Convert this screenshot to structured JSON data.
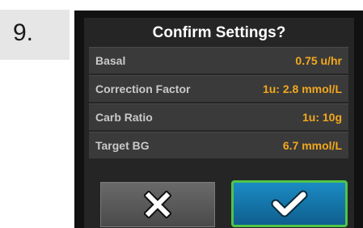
{
  "step": {
    "label": "9."
  },
  "dialog": {
    "title": "Confirm Settings?",
    "rows": [
      {
        "label": "Basal",
        "value": "0.75 u/hr"
      },
      {
        "label": "Correction Factor",
        "value": "1u: 2.8 mmol/L"
      },
      {
        "label": "Carb Ratio",
        "value": "1u: 10g"
      },
      {
        "label": "Target BG",
        "value": "6.7 mmol/L"
      }
    ],
    "cancel_icon": "x-icon",
    "confirm_icon": "checkmark-icon"
  },
  "colors": {
    "value_text": "#f2a81d",
    "confirm_button": "#1b8bc4",
    "confirm_border": "#4fc44a"
  }
}
